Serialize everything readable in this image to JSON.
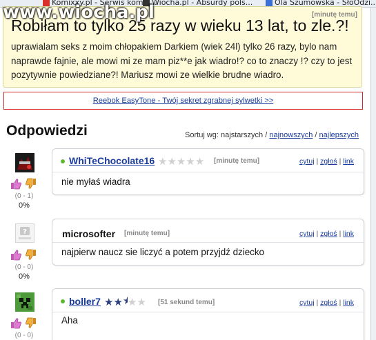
{
  "browser": {
    "bookmarks": [
      {
        "label": "Komixxy.pl - Serwis komik...",
        "color": "#d9302c"
      },
      {
        "label": "Wiocha.pl - Absurdy pols...",
        "color": "#333333"
      },
      {
        "label": "Ola Szumowska - SłoOdzi...",
        "color": "#3a6fd8"
      }
    ]
  },
  "watermark": "www.wiocha.pl",
  "question": {
    "time": "[minutę temu]",
    "title": "Robiłam to tylko 25 razy w wieku 13 lat, to zle.?!",
    "body": "uprawialam seks z moim chłopakiem Darkiem (wiek 24l) tylko 26 razy, bylo nam naprawde fajnie, ale mowi mi ze mam piz**e jak wiadro!? co to znaczy !? czy to jest pozytywnie powiedziane?! Mariusz mowi ze wielkie brudne wiadro."
  },
  "ad": {
    "label": "Reebok EasyTone - Twój sekret zgrabnej sylwetki >>"
  },
  "answers_section": {
    "title": "Odpowiedzi",
    "sort_label": "Sortuj wg:",
    "sort_current": "najstarszych",
    "sort_sep": "/",
    "sort_newest": "najnowszych",
    "sort_best": "najlepszych"
  },
  "answers": [
    {
      "username": "WhiTeChocolate16",
      "online": true,
      "rating": 0,
      "rating_max": 5,
      "time": "[minutę temu]",
      "text": "nie myłaś wiadra",
      "votes": "(0 - 1)",
      "percent": "0%",
      "avatar_icon": "dark-avatar-icon"
    },
    {
      "username": "microsofter",
      "online": false,
      "rating": null,
      "time": "[minutę temu]",
      "text": "najpierw naucz sie liczyć a potem przyjdź dziecko",
      "votes": "(0 - 0)",
      "percent": "0%",
      "avatar_icon": "anonymous-avatar-icon"
    },
    {
      "username": "boller7",
      "online": true,
      "rating": 2.5,
      "rating_max": 5,
      "time": "[51 sekund temu]",
      "text": "Aha",
      "votes": "(0 - 0)",
      "percent": "",
      "avatar_icon": "creeper-avatar-icon"
    }
  ],
  "actions": {
    "quote": "cytuj",
    "report": "zgłoś",
    "link": "link",
    "sep": "|"
  },
  "colors": {
    "link": "#1a3c9c",
    "question_bg": "#fffbd8",
    "ad_border": "#d42a2a",
    "online": "#5cb82e",
    "star_on": "#2c3f7f"
  }
}
